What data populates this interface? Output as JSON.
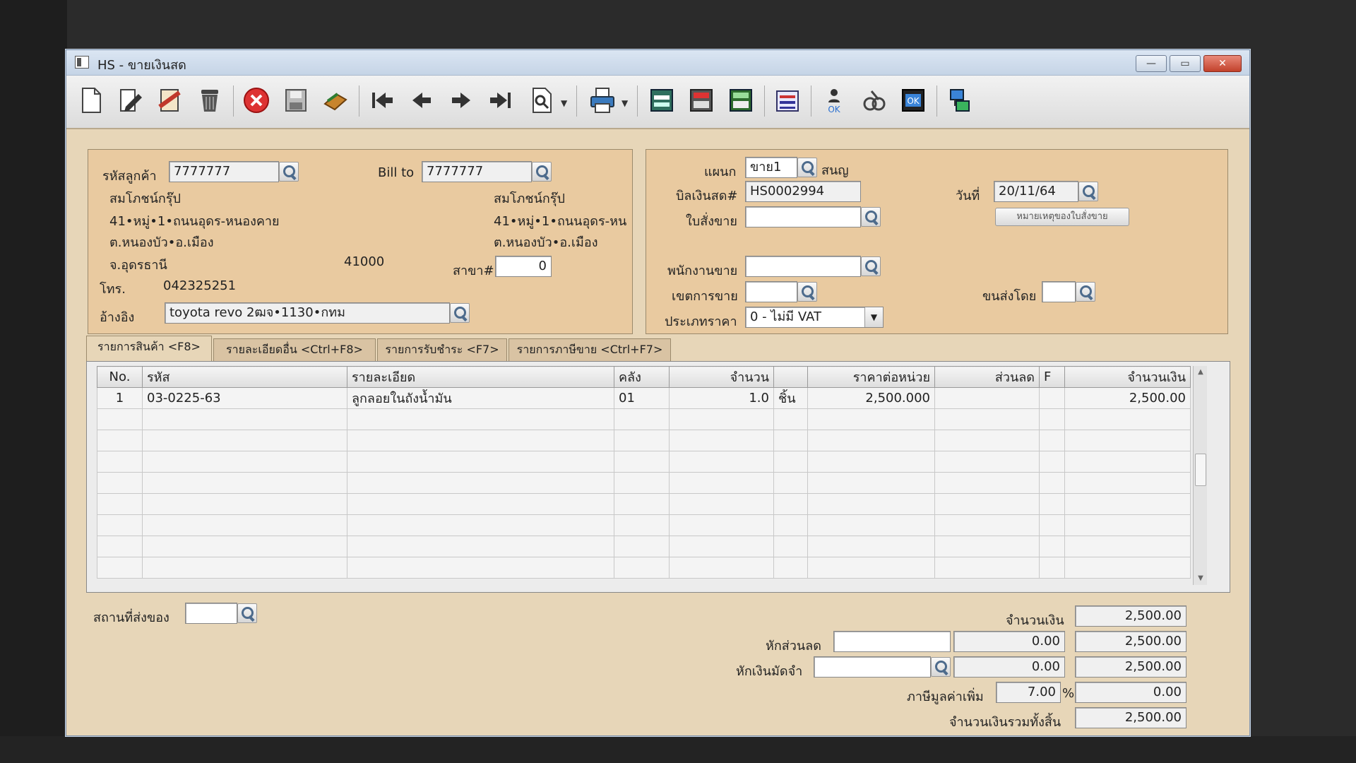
{
  "window": {
    "title": "HS - ขายเงินสด",
    "minimize_symbol": "—",
    "maximize_symbol": "▭",
    "close_symbol": "✕"
  },
  "toolbar": {
    "icons": [
      "new-document-icon",
      "edit-icon",
      "void-icon",
      "delete-bin-icon",
      "cancel-icon",
      "save-icon",
      "import-icon",
      "first-record-icon",
      "previous-record-icon",
      "next-record-icon",
      "last-record-icon",
      "search-document-icon",
      "print-icon",
      "report-icon",
      "calculator-icon",
      "summary-icon",
      "settings-report-icon",
      "approve-user-icon",
      "tools-icon",
      "ok-document-icon",
      "network-icon"
    ]
  },
  "customer": {
    "code_label": "รหัสลูกค้า",
    "code_value": "7777777",
    "name": "สมโภชน์กรุ๊ป",
    "address1": "41•หมู่•1•ถนนอุดร-หนองคาย",
    "address2": "ต.หนองบัว•อ.เมือง",
    "province": "จ.อุดรธานี",
    "postcode": "41000",
    "phone_label": "โทร.",
    "phone": "042325251",
    "ref_label": "อ้างอิง",
    "ref_value": "toyota revo 2ฒจ•1130•กทม"
  },
  "bill_to": {
    "label": "Bill to",
    "code_value": "7777777",
    "name": "สมโภชน์กรุ๊ป",
    "address1": "41•หมู่•1•ถนนอุดร-หน",
    "address2": "ต.หนองบัว•อ.เมือง",
    "branch_label": "สาขา#",
    "branch_value": "0"
  },
  "doc": {
    "dept_label": "แผนก",
    "dept_value": "ขาย1",
    "dept_name": "สนญ",
    "bill_label": "บิลเงินสด#",
    "bill_value": "HS0002994",
    "date_label": "วันที่",
    "date_value": "20/11/64",
    "order_label": "ใบสั่งขาย",
    "order_value": "",
    "order_note_button": "หมายเหตุของใบสั่งขาย",
    "sales_label": "พนักงานขาย",
    "sales_value": "",
    "area_label": "เขตการขาย",
    "area_value": "",
    "ship_label": "ขนส่งโดย",
    "ship_value": "",
    "price_type_label": "ประเภทราคา",
    "price_type_value": "0 - ไม่มี VAT"
  },
  "tabs": [
    {
      "label": "รายการสินค้า <F8>"
    },
    {
      "label": "รายละเอียดอื่น <Ctrl+F8>"
    },
    {
      "label": "รายการรับชำระ <F7>"
    },
    {
      "label": "รายการภาษีขาย <Ctrl+F7>"
    }
  ],
  "grid": {
    "headers": [
      "No.",
      "รหัส",
      "รายละเอียด",
      "คลัง",
      "จำนวน",
      "",
      "ราคาต่อหน่วย",
      "ส่วนลด",
      "F",
      "จำนวนเงิน"
    ],
    "rows": [
      {
        "no": "1",
        "code": "03-0225-63",
        "desc": "ลูกลอยในถังน้ำมัน",
        "store": "01",
        "qty": "1.0",
        "unit": "ชิ้น",
        "price": "2,500.000",
        "discount": "",
        "f": "",
        "amount": "2,500.00"
      }
    ]
  },
  "bottom": {
    "ship_place_label": "สถานที่ส่งของ",
    "ship_place_value": "",
    "amount_label": "จำนวนเงิน",
    "amount_value": "2,500.00",
    "discount_label": "หักส่วนลด",
    "discount_input": "",
    "discount_value": "0.00",
    "discount_total": "2,500.00",
    "deposit_label": "หักเงินมัดจำ",
    "deposit_input": "",
    "deposit_value": "0.00",
    "deposit_total": "2,500.00",
    "vat_label": "ภาษีมูลค่าเพิ่ม",
    "vat_rate": "7.00",
    "vat_percent": "%",
    "vat_value": "0.00",
    "grand_label": "จำนวนเงินรวมทั้งสิ้น",
    "grand_value": "2,500.00"
  }
}
